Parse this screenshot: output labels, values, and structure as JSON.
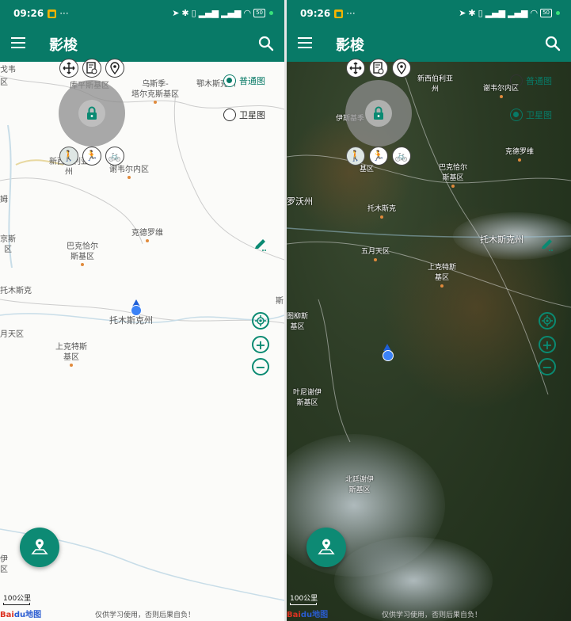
{
  "status_bar": {
    "time": "09:26",
    "dots": "···",
    "battery": "50"
  },
  "app_bar": {
    "title": "影梭"
  },
  "map_types": {
    "normal": "普通图",
    "satellite": "卫星图"
  },
  "normal_places": [
    {
      "name": "戈韦",
      "sub": ""
    },
    {
      "name": "区",
      "sub": ""
    },
    {
      "name": "库平斯基区",
      "sub": ""
    },
    {
      "name": "乌斯季-",
      "sub": "塔尔克斯基区"
    },
    {
      "name": "鄂木斯克州",
      "sub": ""
    },
    {
      "name": "新西伯利亚",
      "sub": "州"
    },
    {
      "name": "谢韦尔内区",
      "sub": ""
    },
    {
      "name": "姆",
      "sub": ""
    },
    {
      "name": "京斯",
      "sub": "区"
    },
    {
      "name": "克德罗维",
      "sub": ""
    },
    {
      "name": "巴克恰尔",
      "sub": "斯基区"
    },
    {
      "name": "托木斯克",
      "sub": ""
    },
    {
      "name": "托木斯克州",
      "sub": ""
    },
    {
      "name": "斯",
      "sub": ""
    },
    {
      "name": "月天区",
      "sub": ""
    },
    {
      "name": "上克特斯",
      "sub": "基区"
    },
    {
      "name": "伊",
      "sub": "区"
    }
  ],
  "sat_places": [
    {
      "name": "新西伯利亚",
      "sub": "州"
    },
    {
      "name": "谢韦尔内区",
      "sub": ""
    },
    {
      "name": "伊斯基季",
      "sub": ""
    },
    {
      "name": "基区",
      "sub": ""
    },
    {
      "name": "巴克恰尔",
      "sub": "斯基区"
    },
    {
      "name": "克德罗维",
      "sub": ""
    },
    {
      "name": "罗沃州",
      "sub": ""
    },
    {
      "name": "托木斯克",
      "sub": ""
    },
    {
      "name": "托木斯克州",
      "sub": ""
    },
    {
      "name": "五月天区",
      "sub": ""
    },
    {
      "name": "上克特斯",
      "sub": "基区"
    },
    {
      "name": "图柳斯",
      "sub": "基区"
    },
    {
      "name": "叶尼谢伊",
      "sub": "斯基区"
    },
    {
      "name": "北廷谢伊",
      "sub": "斯基区"
    }
  ],
  "scale": "100公里",
  "disclaimer": "仅供学习使用，否则后果自负！",
  "baidu": {
    "bai": "Bai",
    "du": "du",
    "map": "地图"
  },
  "colors": {
    "primary": "#087a67",
    "accent": "#0a8a72",
    "location": "#3b82f6"
  }
}
